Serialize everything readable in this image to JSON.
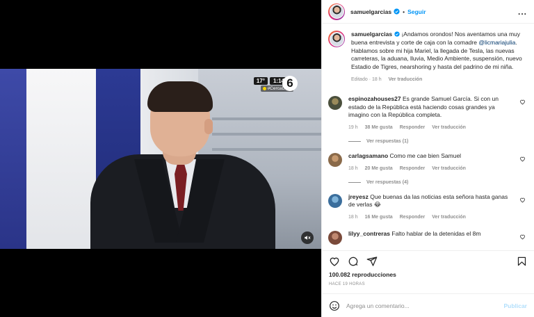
{
  "header": {
    "username": "samuelgarcias",
    "separator": "•",
    "follow_label": "Seguir",
    "more_label": "..."
  },
  "video": {
    "temperature": "17°",
    "clock": "1:14",
    "hashtag": "#CercaDeTi",
    "channel": "6"
  },
  "caption": {
    "username": "samuelgarcias",
    "text_before_mention": " ¡Andamos orondos! Nos aventamos una muy buena entrevista y corte de caja con la comadre ",
    "mention": "@licmariajulia",
    "text_after_mention": ". Hablamos sobre mi hija Mariel, la llegada de Tesla, las nuevas carreteras, la aduana, lluvia, Medio Ambiente, suspensión, nuevo Estadio de Tigres, nearshoring y hasta del padrino de mi niña.",
    "edited": "Editado",
    "time": "18 h",
    "see_translation": "Ver traducción"
  },
  "comments": [
    {
      "username": "espinozahouses27",
      "text": " Es grande Samuel García. Si con un estado de la República está haciendo cosas grandes ya imagino con la República completa.",
      "time": "19 h",
      "likes": "38 Me gusta",
      "reply": "Responder",
      "translate": "Ver traducción",
      "replies": "Ver respuestas (1)",
      "avatar_color": "#4a4f3c"
    },
    {
      "username": "carlagsamano",
      "text": " Como me cae bien Samuel",
      "time": "18 h",
      "likes": "20 Me gusta",
      "reply": "Responder",
      "translate": "Ver traducción",
      "replies": "Ver respuestas (4)",
      "avatar_color": "#8a6a4a"
    },
    {
      "username": "jreyesz",
      "text": " Que buenas da las noticias esta señora hasta ganas de verlas 😂",
      "time": "18 h",
      "likes": "16 Me gusta",
      "reply": "Responder",
      "translate": "Ver traducción",
      "avatar_color": "#3b6e9c"
    },
    {
      "username": "lilyy_contreras",
      "text": " Falto hablar de la detenidas el 8m",
      "avatar_color": "#7a4a3a"
    }
  ],
  "stats": {
    "views": "100.082 reproducciones",
    "time_ago": "HACE 19 HORAS"
  },
  "add_comment": {
    "placeholder": "Agrega un comentario...",
    "post_label": "Publicar"
  },
  "colors": {
    "accent": "#0095f6",
    "verified": "#0095f6",
    "muted": "#8e8e8e",
    "mention": "#00376b"
  }
}
